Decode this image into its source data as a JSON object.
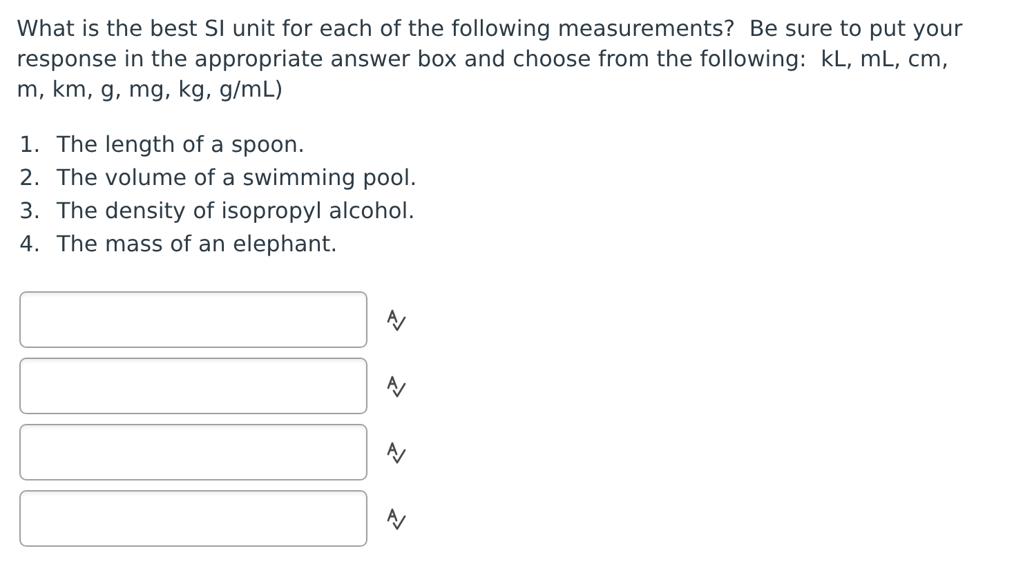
{
  "question": "What is the best SI unit for each of the following measurements?  Be sure to put your response in the appropriate answer box and choose from the following:  kL, mL, cm, m, km, g, mg, kg, g/mL)",
  "items": [
    {
      "number": "1.",
      "text": "The length of a spoon."
    },
    {
      "number": "2.",
      "text": "The volume of a swimming pool."
    },
    {
      "number": "3.",
      "text": "The density of isopropyl alcohol."
    },
    {
      "number": "4.",
      "text": "The mass of an elephant."
    }
  ],
  "answer_fields": [
    {
      "kind": "text",
      "spellcheck": true
    },
    {
      "kind": "text",
      "spellcheck": true
    },
    {
      "kind": "text",
      "spellcheck": true
    },
    {
      "kind": "text",
      "spellcheck": true
    }
  ]
}
